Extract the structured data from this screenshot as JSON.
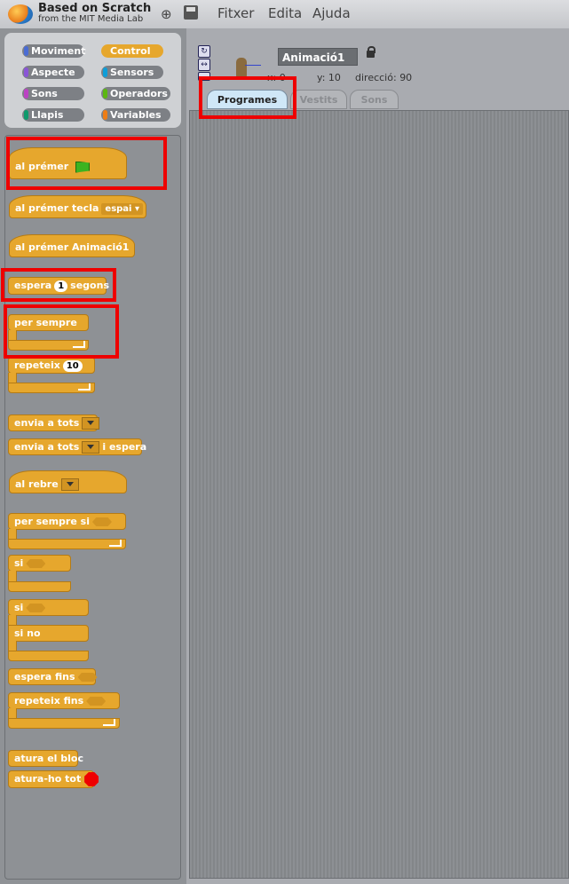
{
  "app": {
    "title_line1": "Based on Scratch",
    "title_line2": "from the MIT Media Lab"
  },
  "menu": {
    "items": [
      "Fitxer",
      "Edita",
      "Ajuda"
    ]
  },
  "categories": [
    {
      "label": "Moviment",
      "color": "#4a6cd4"
    },
    {
      "label": "Control",
      "color": "#e6a72d"
    },
    {
      "label": "Aspecte",
      "color": "#8a55d7"
    },
    {
      "label": "Sensors",
      "color": "#0e9ed8"
    },
    {
      "label": "Sons",
      "color": "#bb42c3"
    },
    {
      "label": "Operadors",
      "color": "#5cb712"
    },
    {
      "label": "Llapis",
      "color": "#0e9a6c"
    },
    {
      "label": "Variables",
      "color": "#ee7d16"
    }
  ],
  "sprite": {
    "name": "Animació1",
    "x_label": "x:",
    "x_value": "0",
    "y_label": "y:",
    "y_value": "10",
    "dir_label": "direcció:",
    "dir_value": "90"
  },
  "tabs": [
    "Programes",
    "Vestits",
    "Sons"
  ],
  "blocks": {
    "when_flag": "al prémer",
    "when_key": "al prémer tecla",
    "when_key_value": "espai",
    "when_clicked": "al prémer  Animació1",
    "wait": "espera",
    "wait_value": "1",
    "wait_unit": "segons",
    "forever": "per sempre",
    "repeat": "repeteix",
    "repeat_value": "10",
    "broadcast": "envia a tots",
    "broadcast_wait": "envia a tots",
    "broadcast_wait_suffix": "i espera",
    "when_receive": "al rebre",
    "forever_if": "per sempre si",
    "if": "si",
    "if_else": "si",
    "else": "si no",
    "wait_until": "espera fins",
    "repeat_until": "repeteix fins",
    "stop_script": "atura el bloc",
    "stop_all": "atura-ho tot"
  }
}
